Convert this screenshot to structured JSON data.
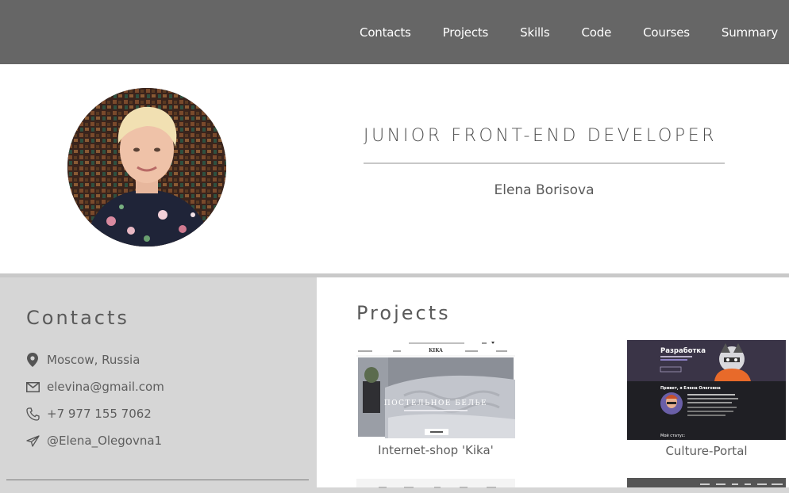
{
  "nav": {
    "items": [
      "Contacts",
      "Projects",
      "Skills",
      "Code",
      "Courses",
      "Summary"
    ]
  },
  "header": {
    "role": "JUNIOR FRONT-END DEVELOPER",
    "name": "Elena Borisova"
  },
  "contacts": {
    "title": "Contacts",
    "items": [
      {
        "icon": "location-pin-icon",
        "text": "Moscow, Russia"
      },
      {
        "icon": "mail-icon",
        "text": "elevina@gmail.com"
      },
      {
        "icon": "phone-icon",
        "text": "+7 977 155 7062"
      },
      {
        "icon": "telegram-icon",
        "text": "@Elena_Olegovna1"
      }
    ]
  },
  "projects": {
    "title": "Projects",
    "cards": [
      {
        "caption": "Internet-shop 'Kika'",
        "thumb": {
          "logo": "KIKA",
          "banner": "ПОСТЕЛЬНОЕ БЕЛЬЕ"
        }
      },
      {
        "caption": "Culture-Portal",
        "thumb": {
          "heading": "Разработка",
          "greeting": "Привет, я Елена Олеговна",
          "status": "Мой статус:"
        }
      }
    ]
  },
  "colors": {
    "topbar": "#666666",
    "sidebar": "#d6d6d6",
    "text": "#5a5a5a"
  }
}
